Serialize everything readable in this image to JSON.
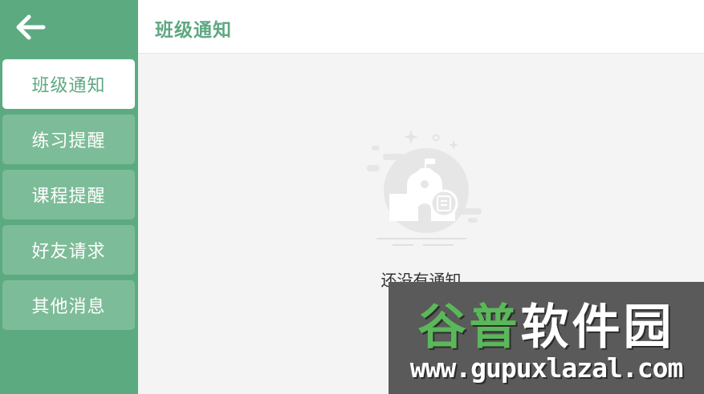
{
  "sidebar": {
    "back_icon": "arrow-left-icon",
    "items": [
      {
        "label": "班级通知",
        "active": true
      },
      {
        "label": "练习提醒",
        "active": false
      },
      {
        "label": "课程提醒",
        "active": false
      },
      {
        "label": "好友请求",
        "active": false
      },
      {
        "label": "其他消息",
        "active": false
      }
    ]
  },
  "header": {
    "title": "班级通知"
  },
  "main": {
    "empty_icon": "school-notice-icon",
    "empty_text": "还没有通知"
  },
  "watermark": {
    "title_part1": "谷普",
    "title_part2": "软件园",
    "url": "www.gupuxlazal.com"
  },
  "colors": {
    "sidebar_bg": "#5cab80",
    "nav_item_bg": "#7dbc98",
    "accent": "#5ea882"
  }
}
